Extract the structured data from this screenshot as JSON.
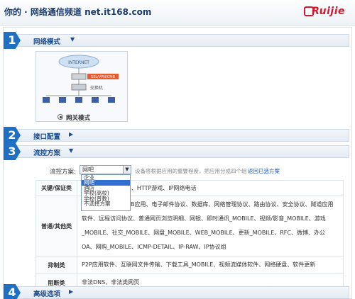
{
  "header": {
    "site_title": "你的 · 网络通信频道  net.it168.com",
    "brand": "Ruijie"
  },
  "sections": {
    "s1": {
      "num": "1",
      "title": "网络模式",
      "caret": "▼"
    },
    "s2": {
      "num": "2",
      "title": "接口配置",
      "caret": "▶"
    },
    "s3": {
      "num": "3",
      "title": "流控方案",
      "caret": "▼"
    },
    "s4": {
      "num": "4",
      "title": "高级选项",
      "caret": "▶"
    }
  },
  "network_mode": {
    "label": "网关模式",
    "diagram_labels": {
      "internet": "INTERNET",
      "router": "SSL/VPN/CMB",
      "switch": "交换机"
    }
  },
  "strategy": {
    "label": "流控方案:",
    "selected": "网吧",
    "hint": "设备将根据应用的重要程度，把应用分成四个组",
    "link": "返回已选方案",
    "options": [
      "企业",
      "网吧",
      "酒店",
      "学校(高校)",
      "学校(普教)",
      "不选择方案"
    ],
    "selected_index": 1
  },
  "table": {
    "rows": [
      {
        "category": "关键/保证类",
        "items": "…、DNS、QQ应用、HTTP游戏、IP网络电话"
      },
      {
        "category": "普通/其他类",
        "items": "…、股票软件、WEB应用、电子邮件协议、数据库、网络管理协议、路由协议、安全协议、隧道应用软件、远程访问协议、普通网页浏览明细、网银、即时通讯_MOBILE、视频/影音_MOBILE、游戏_MOBILE、社交_MOBILE、网盘_MOBILE、WEB_MOBILE、更新_MOBILE、RFC、微博、办公OA、网购_MOBILE、ICMP-DETAIL、IP-RAW、IP协议组"
      },
      {
        "category": "抑制类",
        "items": "P2P应用软件、互联网文件传输、下载工具_MOBILE、视频流媒体软件、网络硬盘、软件更新"
      },
      {
        "category": "阻断类",
        "items": "非法DNS、非法类网页"
      }
    ]
  }
}
